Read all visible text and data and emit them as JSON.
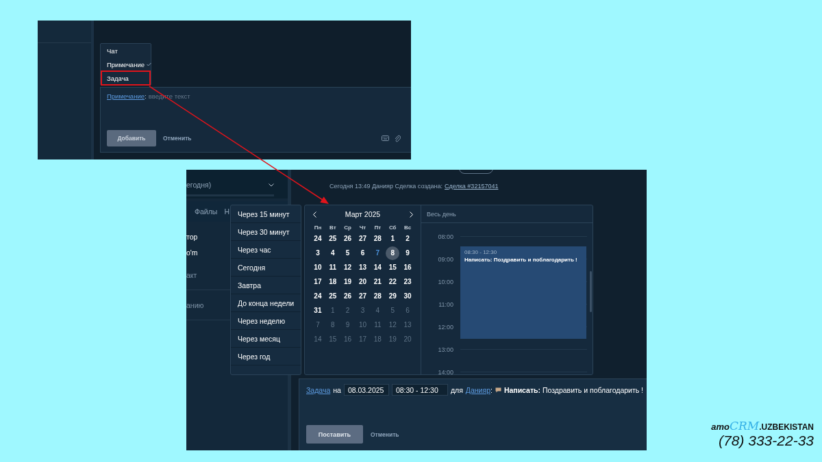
{
  "note_shot": {
    "type_menu": [
      {
        "label": "Чат",
        "checked": false,
        "highlighted": false
      },
      {
        "label": "Примечание",
        "checked": true,
        "highlighted": false
      },
      {
        "label": "Задача",
        "checked": false,
        "highlighted": true
      }
    ],
    "composer": {
      "type_link": "Примечание",
      "separator": ":",
      "placeholder": "введите текст",
      "submit_button": "Добавить",
      "cancel_link": "Отменить"
    }
  },
  "task_shot": {
    "sidebar": {
      "period_filter": "егодня)",
      "tabs": [
        "Файлы",
        "Н"
      ],
      "items": [
        {
          "label": "тор",
          "muted": false
        },
        {
          "label": "o'm",
          "muted": false
        },
        {
          "label": "акт",
          "muted": true
        },
        {
          "label": "анию",
          "muted": true
        }
      ]
    },
    "feed": {
      "log_entry": {
        "text": "Сегодня 13:49 Данияр Сделка создана:",
        "link": "Сделка #32157041"
      }
    },
    "quick_dates": [
      "Через 15 минут",
      "Через 30 минут",
      "Через час",
      "Сегодня",
      "Завтра",
      "До конца недели",
      "Через неделю",
      "Через месяц",
      "Через год"
    ],
    "calendar": {
      "title": "Март 2025",
      "weekdays": [
        "Пн",
        "Вт",
        "Ср",
        "Чт",
        "Пт",
        "Сб",
        "Вс"
      ],
      "weeks": [
        [
          {
            "label": "24",
            "muted": false,
            "today": false,
            "selected": false
          },
          {
            "label": "25",
            "muted": false,
            "today": false,
            "selected": false
          },
          {
            "label": "26",
            "muted": false,
            "today": false,
            "selected": false
          },
          {
            "label": "27",
            "muted": false,
            "today": false,
            "selected": false
          },
          {
            "label": "28",
            "muted": false,
            "today": false,
            "selected": false
          },
          {
            "label": "1",
            "muted": false,
            "today": false,
            "selected": false
          },
          {
            "label": "2",
            "muted": false,
            "today": false,
            "selected": false
          }
        ],
        [
          {
            "label": "3",
            "muted": false,
            "today": false,
            "selected": false
          },
          {
            "label": "4",
            "muted": false,
            "today": false,
            "selected": false
          },
          {
            "label": "5",
            "muted": false,
            "today": false,
            "selected": false
          },
          {
            "label": "6",
            "muted": false,
            "today": false,
            "selected": false
          },
          {
            "label": "7",
            "muted": false,
            "today": true,
            "selected": false
          },
          {
            "label": "8",
            "muted": false,
            "today": false,
            "selected": true
          },
          {
            "label": "9",
            "muted": false,
            "today": false,
            "selected": false
          }
        ],
        [
          {
            "label": "10",
            "muted": false,
            "today": false,
            "selected": false
          },
          {
            "label": "11",
            "muted": false,
            "today": false,
            "selected": false
          },
          {
            "label": "12",
            "muted": false,
            "today": false,
            "selected": false
          },
          {
            "label": "13",
            "muted": false,
            "today": false,
            "selected": false
          },
          {
            "label": "14",
            "muted": false,
            "today": false,
            "selected": false
          },
          {
            "label": "15",
            "muted": false,
            "today": false,
            "selected": false
          },
          {
            "label": "16",
            "muted": false,
            "today": false,
            "selected": false
          }
        ],
        [
          {
            "label": "17",
            "muted": false,
            "today": false,
            "selected": false
          },
          {
            "label": "18",
            "muted": false,
            "today": false,
            "selected": false
          },
          {
            "label": "19",
            "muted": false,
            "today": false,
            "selected": false
          },
          {
            "label": "20",
            "muted": false,
            "today": false,
            "selected": false
          },
          {
            "label": "21",
            "muted": false,
            "today": false,
            "selected": false
          },
          {
            "label": "22",
            "muted": false,
            "today": false,
            "selected": false
          },
          {
            "label": "23",
            "muted": false,
            "today": false,
            "selected": false
          }
        ],
        [
          {
            "label": "24",
            "muted": false,
            "today": false,
            "selected": false
          },
          {
            "label": "25",
            "muted": false,
            "today": false,
            "selected": false
          },
          {
            "label": "26",
            "muted": false,
            "today": false,
            "selected": false
          },
          {
            "label": "27",
            "muted": false,
            "today": false,
            "selected": false
          },
          {
            "label": "28",
            "muted": false,
            "today": false,
            "selected": false
          },
          {
            "label": "29",
            "muted": false,
            "today": false,
            "selected": false
          },
          {
            "label": "30",
            "muted": false,
            "today": false,
            "selected": false
          }
        ],
        [
          {
            "label": "31",
            "muted": false,
            "today": false,
            "selected": false
          },
          {
            "label": "1",
            "muted": true,
            "today": false,
            "selected": false
          },
          {
            "label": "2",
            "muted": true,
            "today": false,
            "selected": false
          },
          {
            "label": "3",
            "muted": true,
            "today": false,
            "selected": false
          },
          {
            "label": "4",
            "muted": true,
            "today": false,
            "selected": false
          },
          {
            "label": "5",
            "muted": true,
            "today": false,
            "selected": false
          },
          {
            "label": "6",
            "muted": true,
            "today": false,
            "selected": false
          }
        ],
        [
          {
            "label": "7",
            "muted": true,
            "today": false,
            "selected": false
          },
          {
            "label": "8",
            "muted": true,
            "today": false,
            "selected": false
          },
          {
            "label": "9",
            "muted": true,
            "today": false,
            "selected": false
          },
          {
            "label": "10",
            "muted": true,
            "today": false,
            "selected": false
          },
          {
            "label": "11",
            "muted": true,
            "today": false,
            "selected": false
          },
          {
            "label": "12",
            "muted": true,
            "today": false,
            "selected": false
          },
          {
            "label": "13",
            "muted": true,
            "today": false,
            "selected": false
          }
        ],
        [
          {
            "label": "14",
            "muted": true,
            "today": false,
            "selected": false
          },
          {
            "label": "15",
            "muted": true,
            "today": false,
            "selected": false
          },
          {
            "label": "16",
            "muted": true,
            "today": false,
            "selected": false
          },
          {
            "label": "17",
            "muted": true,
            "today": false,
            "selected": false
          },
          {
            "label": "18",
            "muted": true,
            "today": false,
            "selected": false
          },
          {
            "label": "19",
            "muted": true,
            "today": false,
            "selected": false
          },
          {
            "label": "20",
            "muted": true,
            "today": false,
            "selected": false
          }
        ]
      ]
    },
    "day_view": {
      "all_day_label": "Весь день",
      "hours": [
        "08:00",
        "09:00",
        "10:00",
        "11:00",
        "12:00",
        "13:00",
        "14:00"
      ],
      "event": {
        "time": "08:30 - 12:30",
        "title": "Написать: Поздравить и поблагодарить !"
      }
    },
    "task_composer": {
      "type_link": "Задача",
      "on_word": "на",
      "date": "08.03.2025",
      "time": "08:30 - 12:30",
      "for_word": "для",
      "assignee": "Данияр",
      "separator": ":",
      "message": "**Написать:** Поздравить и поблагодарить !",
      "submit_button": "Поставить",
      "cancel_link": "Отменить"
    }
  },
  "branding": {
    "logo": {
      "prefix": "amo",
      "mark": "CRM",
      "suffix": ".UZBEKISTAN"
    },
    "phone": "(78) 333-22-33"
  }
}
